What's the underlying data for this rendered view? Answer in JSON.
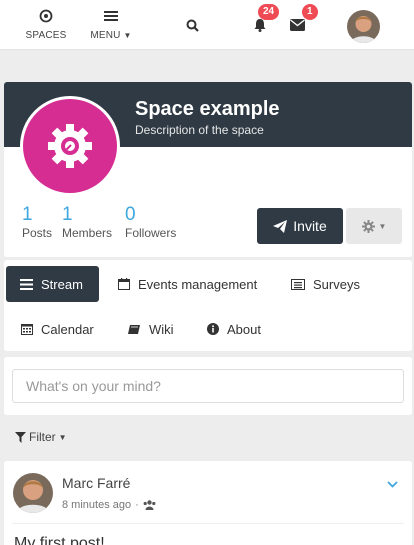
{
  "topnav": {
    "spaces_label": "SPACES",
    "menu_label": "MENU",
    "notifications_count": "24",
    "messages_count": "1"
  },
  "space": {
    "title": "Space example",
    "description": "Description of the space",
    "logo_color": "#d62d92",
    "stats": [
      {
        "num": "1",
        "label": "Posts"
      },
      {
        "num": "1",
        "label": "Members"
      },
      {
        "num": "0",
        "label": "Followers"
      }
    ],
    "invite_label": "Invite"
  },
  "tabs": [
    {
      "label": "Stream",
      "icon": "bars-icon",
      "active": true
    },
    {
      "label": "Events management",
      "icon": "calendar-icon"
    },
    {
      "label": "Surveys",
      "icon": "list-icon"
    },
    {
      "label": "Calendar",
      "icon": "calendar-grid-icon"
    },
    {
      "label": "Wiki",
      "icon": "book-icon"
    },
    {
      "label": "About",
      "icon": "info-icon"
    }
  ],
  "composer": {
    "placeholder": "What's on your mind?"
  },
  "filter": {
    "label": "Filter"
  },
  "post": {
    "author": "Marc Farré",
    "time": "8 minutes ago",
    "content": "My first post!"
  },
  "colors": {
    "accent": "#2f3a44",
    "link": "#3fa7dd",
    "badge": "#ef4b54"
  }
}
